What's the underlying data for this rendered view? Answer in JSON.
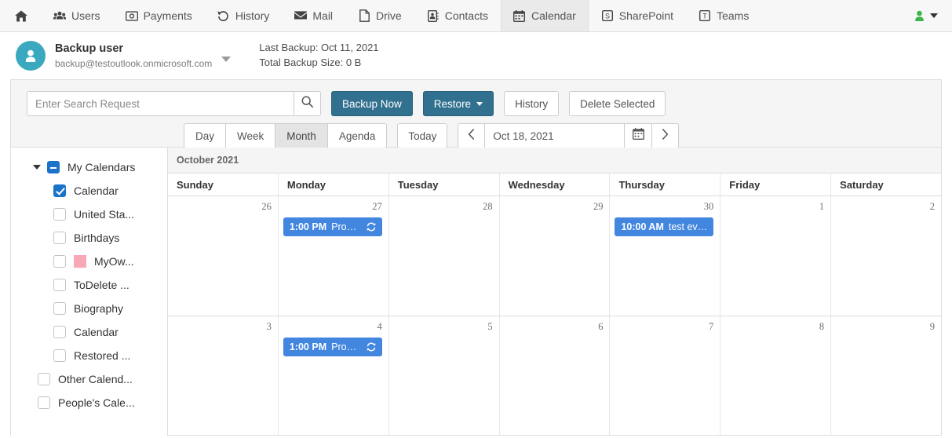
{
  "topnav": {
    "items": [
      {
        "label": "",
        "icon": "home-icon",
        "name": "nav-home",
        "active": false
      },
      {
        "label": "Users",
        "icon": "users-icon",
        "name": "nav-users",
        "active": false
      },
      {
        "label": "Payments",
        "icon": "payments-icon",
        "name": "nav-payments",
        "active": false
      },
      {
        "label": "History",
        "icon": "history-icon",
        "name": "nav-history",
        "active": false
      },
      {
        "label": "Mail",
        "icon": "mail-icon",
        "name": "nav-mail",
        "active": false
      },
      {
        "label": "Drive",
        "icon": "drive-icon",
        "name": "nav-drive",
        "active": false
      },
      {
        "label": "Contacts",
        "icon": "contacts-icon",
        "name": "nav-contacts",
        "active": false
      },
      {
        "label": "Calendar",
        "icon": "calendar-icon",
        "name": "nav-calendar",
        "active": true
      },
      {
        "label": "SharePoint",
        "icon": "sharepoint-icon",
        "name": "nav-sharepoint",
        "active": false
      },
      {
        "label": "Teams",
        "icon": "teams-icon",
        "name": "nav-teams",
        "active": false
      }
    ],
    "user_menu_icon": "user-green-icon"
  },
  "account": {
    "name": "Backup user",
    "email": "backup@testoutlook.onmicrosoft.com",
    "last_backup": "Last Backup: Oct 11, 2021",
    "total_size": "Total Backup Size: 0 B",
    "avatar_color": "#3aa9bf"
  },
  "toolbar": {
    "search_placeholder": "Enter Search Request",
    "search_value": "",
    "backup_now": "Backup Now",
    "restore": "Restore",
    "history": "History",
    "delete_selected": "Delete Selected",
    "views": [
      "Day",
      "Week",
      "Month",
      "Agenda"
    ],
    "selected_view": "Month",
    "today": "Today",
    "date_value": "Oct 18, 2021",
    "primary_color": "#31708f"
  },
  "sidebar": {
    "items": [
      {
        "label": "My Calendars",
        "level": 1,
        "checkbox": "minus",
        "twisty": true,
        "swatch": null
      },
      {
        "label": "Calendar",
        "level": 2,
        "checkbox": "checked",
        "swatch": null
      },
      {
        "label": "United Sta...",
        "level": 2,
        "checkbox": "empty",
        "swatch": null
      },
      {
        "label": "Birthdays",
        "level": 2,
        "checkbox": "empty",
        "swatch": null
      },
      {
        "label": "MyOw...",
        "level": 2,
        "checkbox": "empty",
        "swatch": "#f7a8b4"
      },
      {
        "label": "ToDelete ...",
        "level": 2,
        "checkbox": "empty",
        "swatch": null
      },
      {
        "label": "Biography",
        "level": 2,
        "checkbox": "empty",
        "swatch": null
      },
      {
        "label": "Calendar",
        "level": 2,
        "checkbox": "empty",
        "swatch": null
      },
      {
        "label": "Restored ...",
        "level": 2,
        "checkbox": "empty",
        "swatch": null
      },
      {
        "label": "Other Calend...",
        "level": 1.5,
        "checkbox": "empty",
        "swatch": null
      },
      {
        "label": "People's Cale...",
        "level": 1.5,
        "checkbox": "empty",
        "swatch": null
      }
    ]
  },
  "calendar": {
    "month_title": "October 2021",
    "day_headers": [
      "Sunday",
      "Monday",
      "Tuesday",
      "Wednesday",
      "Thursday",
      "Friday",
      "Saturday"
    ],
    "event_color": "#4286e0",
    "weeks": [
      {
        "days": [
          {
            "num": "26",
            "events": []
          },
          {
            "num": "27",
            "events": [
              {
                "time": "1:00 PM",
                "title": "Prodict...",
                "icon": "recurring-icon"
              }
            ]
          },
          {
            "num": "28",
            "events": []
          },
          {
            "num": "29",
            "events": []
          },
          {
            "num": "30",
            "events": [
              {
                "time": "10:00 AM",
                "title": "test event",
                "icon": null
              }
            ]
          },
          {
            "num": "1",
            "events": []
          },
          {
            "num": "2",
            "events": []
          }
        ]
      },
      {
        "days": [
          {
            "num": "3",
            "events": []
          },
          {
            "num": "4",
            "events": [
              {
                "time": "1:00 PM",
                "title": "Prodict...",
                "icon": "recurring-icon"
              }
            ]
          },
          {
            "num": "5",
            "events": []
          },
          {
            "num": "6",
            "events": []
          },
          {
            "num": "7",
            "events": []
          },
          {
            "num": "8",
            "events": []
          },
          {
            "num": "9",
            "events": []
          }
        ]
      }
    ]
  }
}
